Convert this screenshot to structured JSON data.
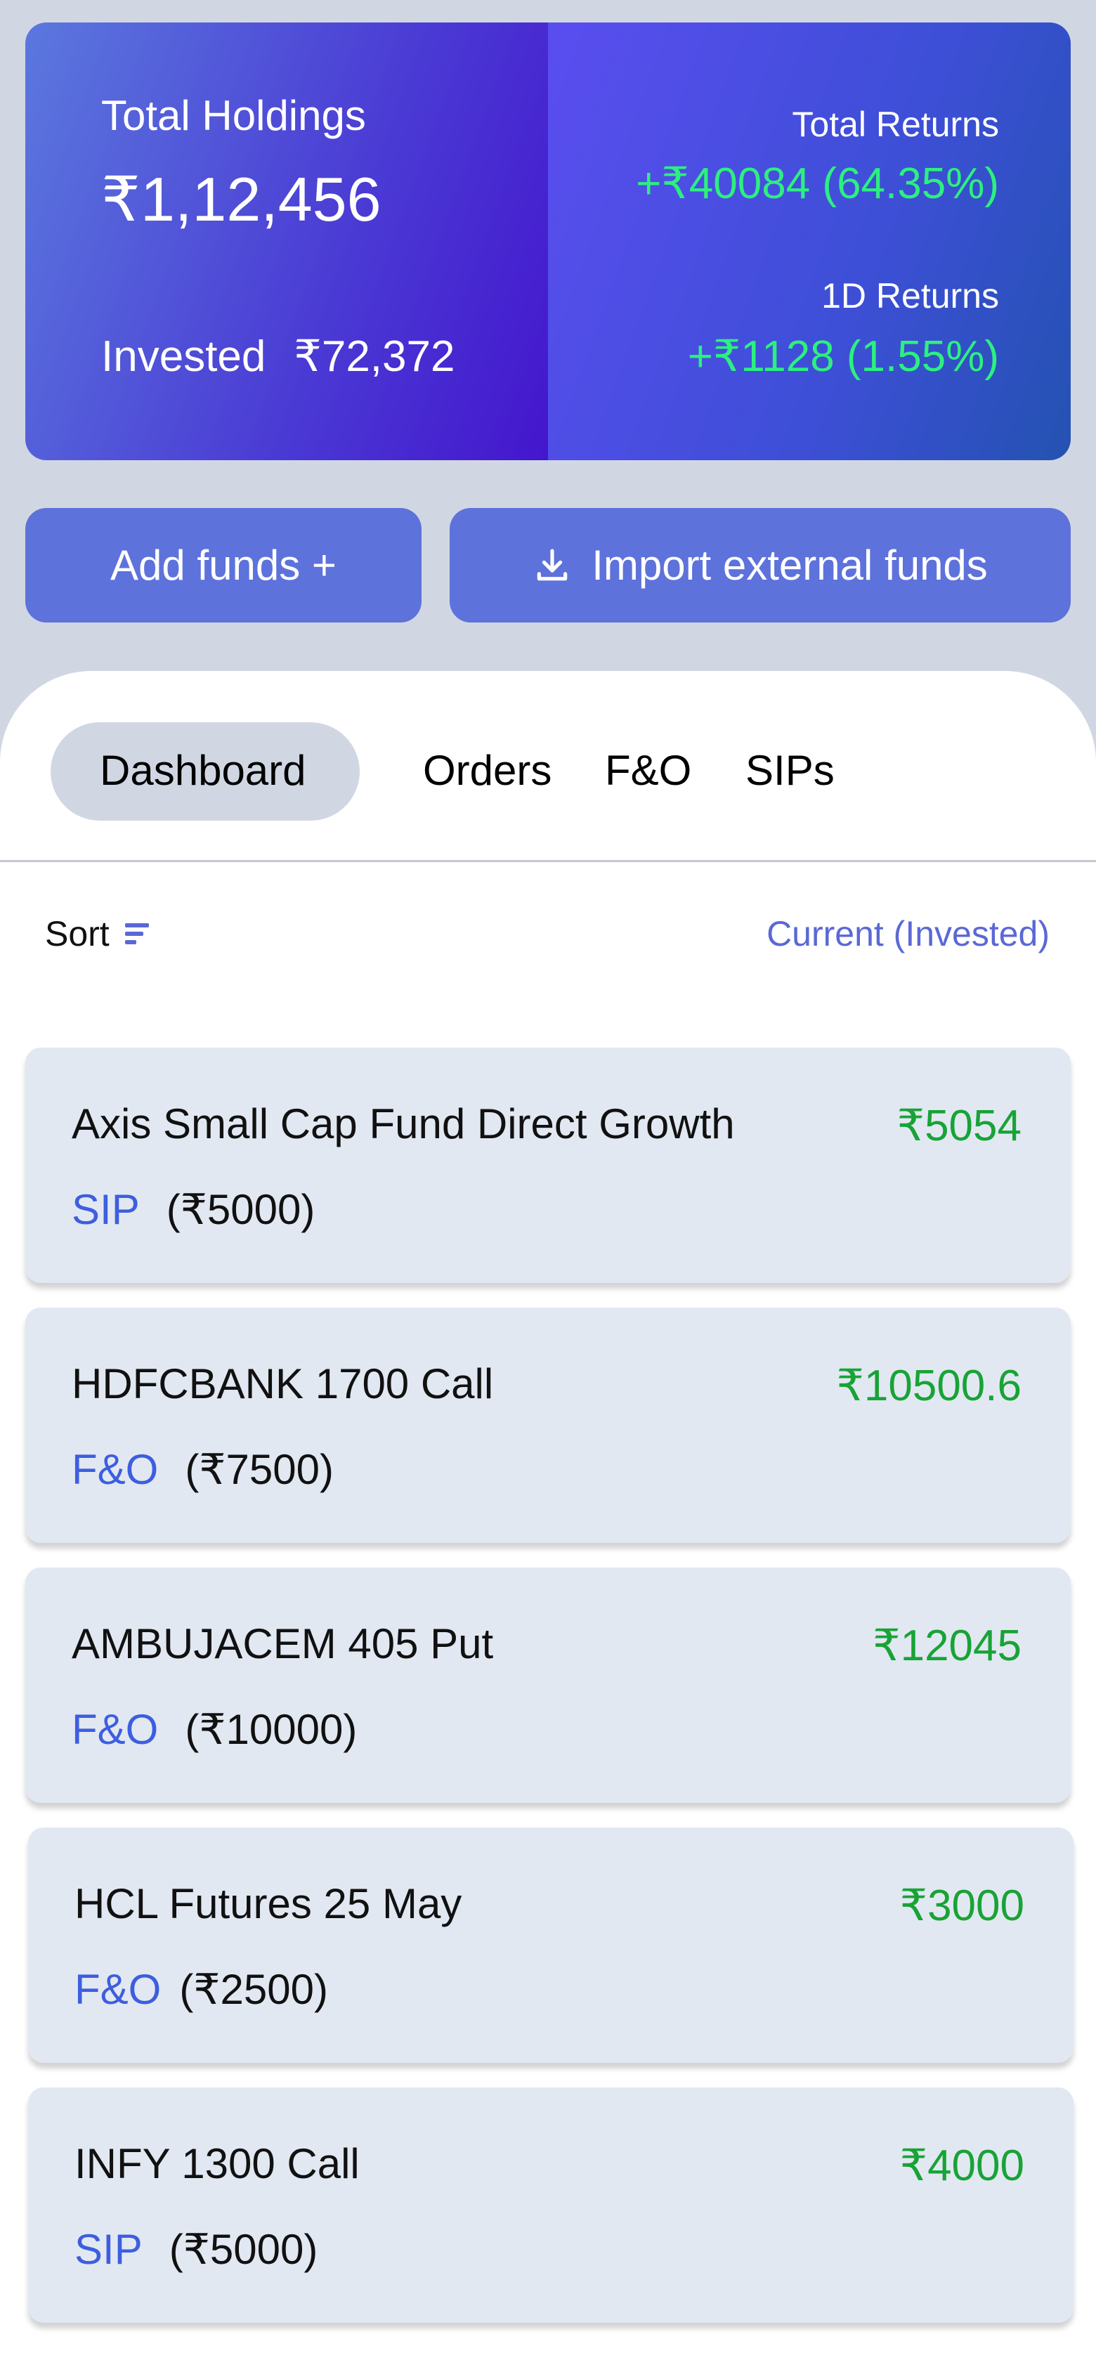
{
  "summary": {
    "total_holdings_label": "Total Holdings",
    "total_holdings_value": "₹1,12,456",
    "invested_label": "Invested",
    "invested_value": "₹72,372",
    "total_returns_label": "Total Returns",
    "total_returns_value": "+₹40084 (64.35%)",
    "one_day_returns_label": "1D Returns",
    "one_day_returns_value": "+₹1128 (1.55%)"
  },
  "actions": {
    "add_funds_label": "Add funds +",
    "import_label": "Import external funds",
    "import_icon": "download-icon"
  },
  "tabs": [
    {
      "label": "Dashboard",
      "active": true
    },
    {
      "label": "Orders",
      "active": false
    },
    {
      "label": "F&O",
      "active": false
    },
    {
      "label": "SIPs",
      "active": false
    }
  ],
  "list_header": {
    "sort_label": "Sort",
    "sort_icon": "sort-icon",
    "view_label": "Current (Invested)"
  },
  "holdings": [
    {
      "name": "Axis Small Cap Fund Direct Growth",
      "type": "SIP",
      "invested": "(₹5000)",
      "current": "₹5054"
    },
    {
      "name": "HDFCBANK 1700 Call",
      "type": "F&O",
      "invested": "(₹7500)",
      "current": "₹10500.6"
    },
    {
      "name": "AMBUJACEM 405 Put",
      "type": "F&O",
      "invested": "(₹10000)",
      "current": "₹12045"
    },
    {
      "name": "HCL Futures 25 May",
      "type": "F&O",
      "invested": "(₹2500)",
      "current": "₹3000"
    },
    {
      "name": "INFY 1300 Call",
      "type": "SIP",
      "invested": "(₹5000)",
      "current": "₹4000"
    }
  ],
  "colors": {
    "positive_return": "#2cf07f",
    "holding_value": "#18a336",
    "accent": "#5e72dc",
    "type_label": "#3d5ee0"
  }
}
